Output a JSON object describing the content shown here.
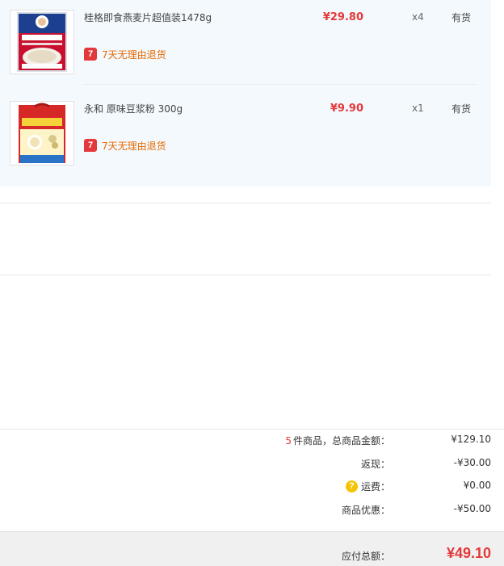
{
  "items": [
    {
      "name": "桂格即食燕麦片超值装1478g",
      "price": "¥29.80",
      "quantity": "x4",
      "stock": "有货",
      "return_badge_icon": "7",
      "return_badge_text": "7天无理由退货",
      "product_image": "quaker-oats-package"
    },
    {
      "name": "永和 原味豆浆粉 300g",
      "price": "¥9.90",
      "quantity": "x1",
      "stock": "有货",
      "return_badge_icon": "7",
      "return_badge_text": "7天无理由退货",
      "product_image": "yonghe-soymilk-powder-package"
    }
  ],
  "summary": {
    "item_count": "5",
    "item_count_suffix": "件商品，总商品金额：",
    "item_total": "¥129.10",
    "rebate_label": "返现：",
    "rebate_value": "-¥30.00",
    "shipping_label": "运费：",
    "shipping_value": "¥0.00",
    "discount_label": "商品优惠：",
    "discount_value": "-¥50.00",
    "payable_label": "应付总额：",
    "payable_value": "¥49.10"
  },
  "colors": {
    "price_red": "#e4393c",
    "return_orange": "#e96a00",
    "panel_bg": "#f3f9fd",
    "help_icon_yellow": "#f5c400"
  }
}
